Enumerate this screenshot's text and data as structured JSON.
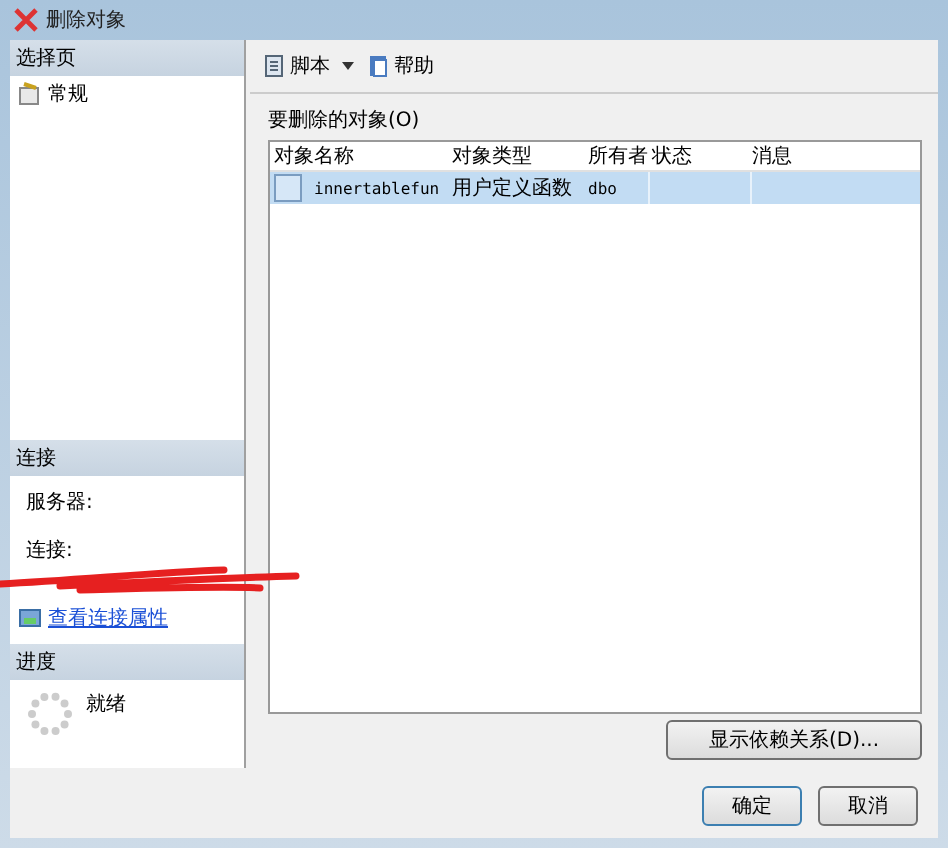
{
  "window": {
    "title": "删除对象"
  },
  "sidebar": {
    "header": "选择页",
    "items": [
      {
        "label": "常规",
        "selected": false
      }
    ]
  },
  "connection": {
    "header": "连接",
    "server_label": "服务器:",
    "connection_label": "连接:",
    "link": "查看连接属性"
  },
  "progress": {
    "header": "进度",
    "status": "就绪"
  },
  "toolbar": {
    "script": "脚本",
    "help": "帮助"
  },
  "objects": {
    "label": "要删除的对象(O)",
    "columns": [
      "对象名称",
      "对象类型",
      "所有者",
      "状态",
      "消息"
    ],
    "rows": [
      {
        "cells": [
          "innertablefun",
          "用户定义函数",
          "dbo",
          "",
          ""
        ],
        "selected": true
      }
    ]
  },
  "buttons": {
    "dependencies": "显示依赖关系(D)...",
    "ok": "确定",
    "cancel": "取消"
  }
}
